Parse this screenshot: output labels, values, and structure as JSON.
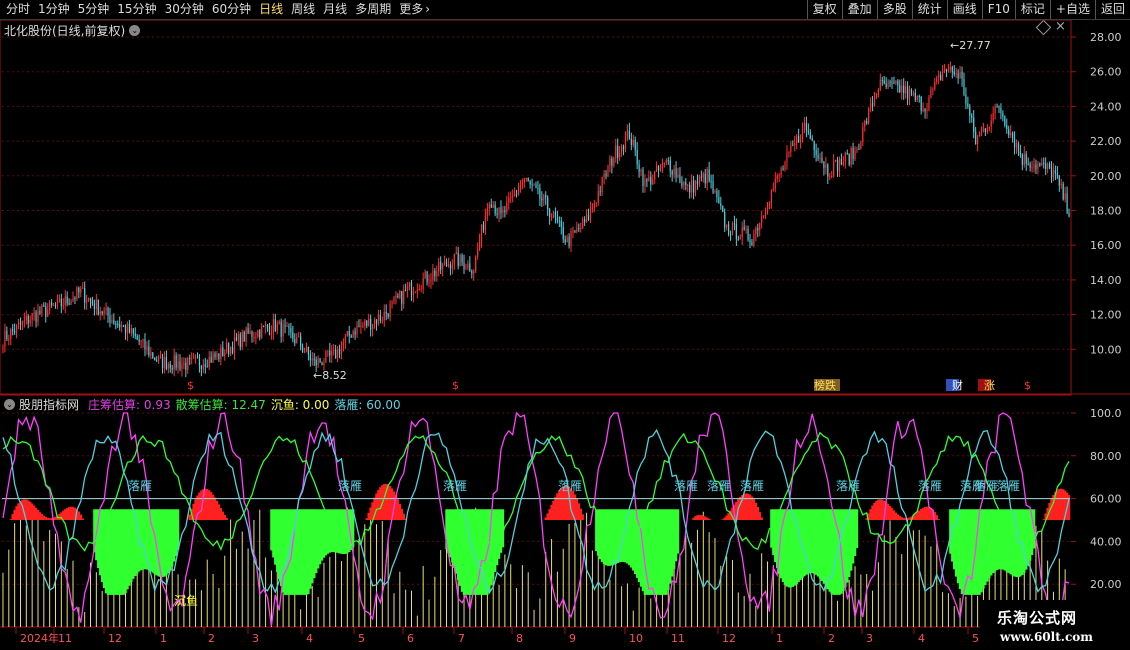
{
  "toolbar": {
    "periods": [
      "分时",
      "1分钟",
      "5分钟",
      "15分钟",
      "30分钟",
      "60分钟",
      "日线",
      "周线",
      "月线",
      "多周期",
      "更多"
    ],
    "active_period": "日线",
    "actions": [
      "复权",
      "叠加",
      "多股",
      "统计",
      "画线",
      "F10",
      "标记",
      "+自选",
      "返回"
    ]
  },
  "stock": {
    "title": "北化股份(日线,前复权)"
  },
  "indicator": {
    "name": "股朋指标网",
    "items": [
      {
        "label": "庄筹估算:",
        "value": "0.93",
        "color": "#e040e0"
      },
      {
        "label": "散筹估算:",
        "value": "12.47",
        "color": "#40e040"
      },
      {
        "label": "沉鱼:",
        "value": "0.00",
        "color": "#ffff40"
      },
      {
        "label": "落雁:",
        "value": "60.00",
        "color": "#60d0e0"
      }
    ]
  },
  "watermark": {
    "line1": "乐淘公式网",
    "line2": "www.60lt.com"
  },
  "chart_data": [
    {
      "type": "candlestick",
      "ylim": [
        8,
        29
      ],
      "yticks": [
        "28.00",
        "26.00",
        "24.00",
        "22.00",
        "20.00",
        "18.00",
        "16.00",
        "14.00",
        "12.00",
        "10.00"
      ],
      "annotations": {
        "high": "27.77",
        "low": "8.52"
      },
      "markers": [
        "$",
        "$",
        "榜跌",
        "财",
        "涨",
        "$"
      ],
      "keypoints": [
        [
          0,
          10.6
        ],
        [
          15,
          11.9
        ],
        [
          30,
          12.6
        ],
        [
          40,
          13.3
        ],
        [
          52,
          12.1
        ],
        [
          65,
          11.0
        ],
        [
          80,
          9.3
        ],
        [
          96,
          9.1
        ],
        [
          110,
          9.6
        ],
        [
          125,
          10.8
        ],
        [
          140,
          11.4
        ],
        [
          152,
          10.4
        ],
        [
          160,
          9.2
        ],
        [
          170,
          9.6
        ],
        [
          180,
          11.1
        ],
        [
          195,
          11.9
        ],
        [
          208,
          13.4
        ],
        [
          220,
          14.3
        ],
        [
          232,
          15.2
        ],
        [
          242,
          14.7
        ],
        [
          250,
          18.8
        ],
        [
          256,
          17.6
        ],
        [
          268,
          19.8
        ],
        [
          280,
          18.2
        ],
        [
          290,
          16.2
        ],
        [
          300,
          17.4
        ],
        [
          314,
          21.2
        ],
        [
          322,
          22.4
        ],
        [
          330,
          19.5
        ],
        [
          342,
          20.8
        ],
        [
          352,
          19.2
        ],
        [
          362,
          20.0
        ],
        [
          372,
          17.0
        ],
        [
          385,
          16.4
        ],
        [
          398,
          19.8
        ],
        [
          412,
          22.9
        ],
        [
          424,
          20.3
        ],
        [
          438,
          21.3
        ],
        [
          450,
          25.2
        ],
        [
          462,
          25.0
        ],
        [
          474,
          24.0
        ],
        [
          484,
          26.2
        ],
        [
          492,
          25.8
        ],
        [
          500,
          22.0
        ],
        [
          512,
          24.0
        ],
        [
          524,
          21.0
        ],
        [
          540,
          20.2
        ],
        [
          548,
          18.0
        ]
      ]
    },
    {
      "type": "indicator",
      "ylim": [
        0,
        100
      ],
      "yticks": [
        "100.0",
        "80.00",
        "60.00",
        "40.00",
        "20.00"
      ],
      "reference_level": 60,
      "labels": [
        "落雁",
        "落雁",
        "落雁",
        "落雁",
        "落雁",
        "落雁",
        "落雁",
        "落雁",
        "落雁",
        "落雁",
        "落雁",
        "落雁",
        "沉鱼"
      ]
    }
  ],
  "axis": {
    "x_labels": [
      "2024年",
      "11",
      "12",
      "1",
      "2",
      "3",
      "4",
      "5",
      "6",
      "7",
      "8",
      "9",
      "10",
      "11",
      "12",
      "1",
      "2",
      "3",
      "4",
      "5"
    ]
  }
}
